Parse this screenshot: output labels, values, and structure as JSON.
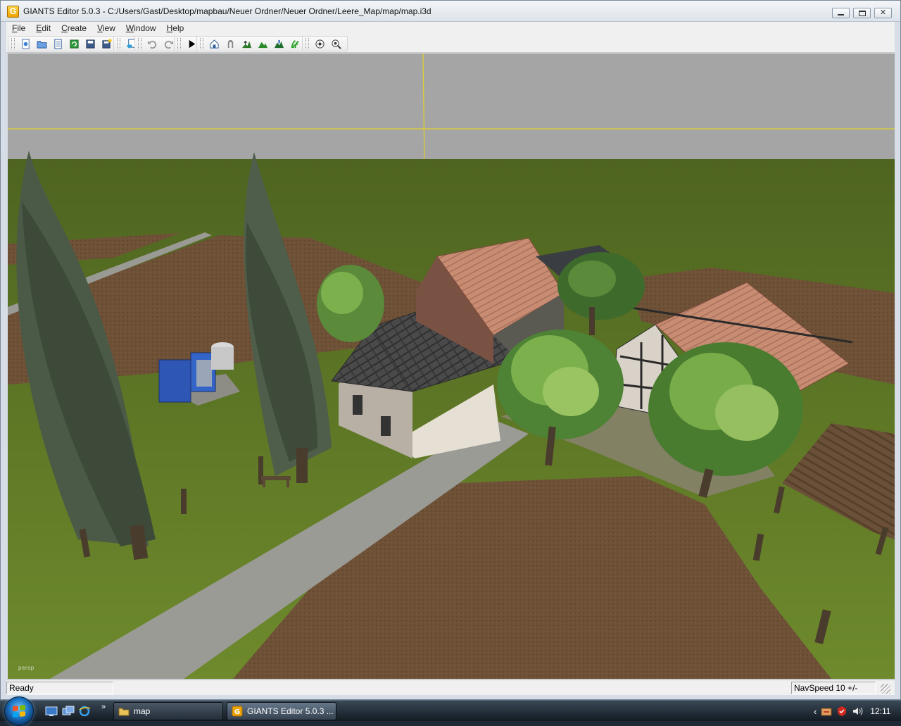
{
  "window": {
    "title": "GIANTS Editor 5.0.3 - C:/Users/Gast/Desktop/mapbau/Neuer Ordner/Neuer Ordner/Leere_Map/map/map.i3d",
    "app_icon_letter": "G"
  },
  "menu": [
    "File",
    "Edit",
    "Create",
    "View",
    "Window",
    "Help"
  ],
  "toolbar": {
    "icons": [
      "new-icon",
      "open-icon",
      "script-icon",
      "refresh-icon",
      "save-icon",
      "save-as-icon",
      "import-icon",
      "undo-icon",
      "redo-icon",
      "play-icon",
      "home-icon",
      "arch-icon",
      "terrain-raise-icon",
      "terrain-paint-icon",
      "terrain-smooth-icon",
      "foliage-paint-icon",
      "select-icon",
      "deselect-icon"
    ]
  },
  "viewport": {
    "camera_label": "persp"
  },
  "status": {
    "left": "Ready",
    "right": "NavSpeed 10 +/-"
  },
  "taskbar": {
    "tasks": [
      {
        "label": "map"
      },
      {
        "label": "GIANTS Editor 5.0.3 ..."
      }
    ],
    "clock": "12:11",
    "more": "»"
  }
}
